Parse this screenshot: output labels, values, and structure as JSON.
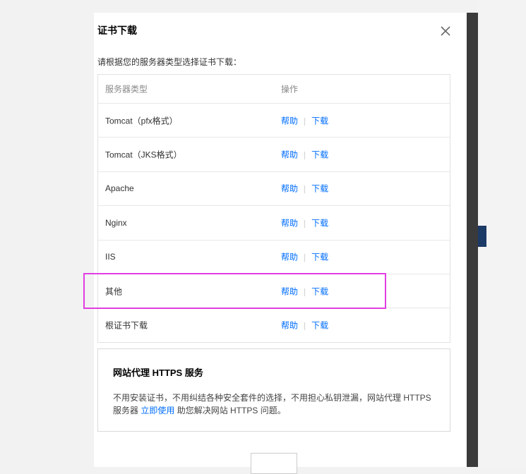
{
  "dialog": {
    "title": "证书下载",
    "close_icon": "close-icon",
    "instruction": "请根据您的服务器类型选择证书下载："
  },
  "table": {
    "headers": {
      "type": "服务器类型",
      "op": "操作"
    },
    "rows": [
      {
        "type": "Tomcat（pfx格式）",
        "help": "帮助",
        "download": "下载"
      },
      {
        "type": "Tomcat（JKS格式）",
        "help": "帮助",
        "download": "下载"
      },
      {
        "type": "Apache",
        "help": "帮助",
        "download": "下载"
      },
      {
        "type": "Nginx",
        "help": "帮助",
        "download": "下载"
      },
      {
        "type": "IIS",
        "help": "帮助",
        "download": "下载"
      },
      {
        "type": "其他",
        "help": "帮助",
        "download": "下载"
      },
      {
        "type": "根证书下载",
        "help": "帮助",
        "download": "下载"
      }
    ],
    "separator": "|"
  },
  "proxy": {
    "title": "网站代理 HTTPS 服务",
    "desc_part1": "不用安装证书，不用纠结各种安全套件的选择，不用担心私钥泄漏，网站代理 HTTPS 服务器 ",
    "desc_link": "立即使用",
    "desc_part2": " 助您解决网站 HTTPS 问题。"
  },
  "colors": {
    "link": "#006eff",
    "highlight": "#e23ee2"
  }
}
